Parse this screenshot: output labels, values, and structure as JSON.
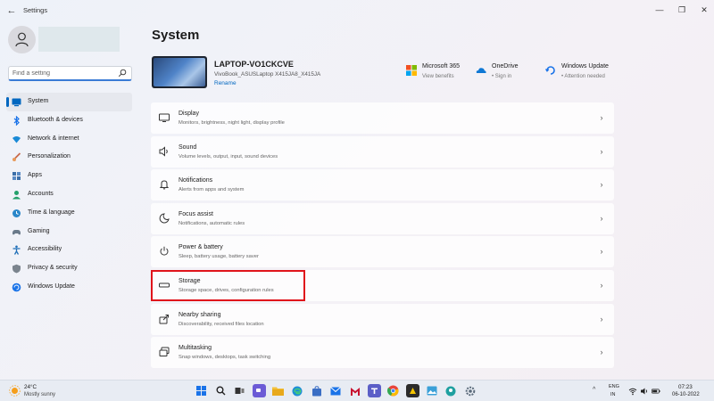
{
  "window": {
    "title": "Settings",
    "back_icon": "back-arrow-icon",
    "controls": {
      "minimize": "—",
      "maximize": "❐",
      "close": "✕"
    }
  },
  "sidebar": {
    "search_placeholder": "Find a setting",
    "items": [
      {
        "label": "System",
        "icon": "system-icon",
        "active": true,
        "color": "#0067c0"
      },
      {
        "label": "Bluetooth & devices",
        "icon": "bluetooth-icon",
        "color": "#1a73e8"
      },
      {
        "label": "Network & internet",
        "icon": "wifi-icon",
        "color": "#1a8ad6"
      },
      {
        "label": "Personalization",
        "icon": "brush-icon",
        "color": "#c8694a"
      },
      {
        "label": "Apps",
        "icon": "apps-icon",
        "color": "#3b6ea8"
      },
      {
        "label": "Accounts",
        "icon": "person-icon",
        "color": "#25a06b"
      },
      {
        "label": "Time & language",
        "icon": "globe-clock-icon",
        "color": "#2a87c9"
      },
      {
        "label": "Gaming",
        "icon": "gamepad-icon",
        "color": "#6a7a8a"
      },
      {
        "label": "Accessibility",
        "icon": "accessibility-icon",
        "color": "#1f6fb8"
      },
      {
        "label": "Privacy & security",
        "icon": "shield-icon",
        "color": "#7b848e"
      },
      {
        "label": "Windows Update",
        "icon": "update-icon",
        "color": "#1a73e8"
      }
    ]
  },
  "main": {
    "title": "System",
    "device": {
      "name": "LAPTOP-VO1CKCVE",
      "model": "VivoBook_ASUSLaptop X415JA8_X415JA",
      "rename": "Rename"
    },
    "quick_links": [
      {
        "title": "Microsoft 365",
        "sub": "View benefits",
        "icon": "microsoft-365-icon"
      },
      {
        "title": "OneDrive",
        "sub": "• Sign in",
        "icon": "onedrive-icon"
      },
      {
        "title": "Windows Update",
        "sub": "• Attention needed",
        "icon": "windows-update-icon"
      }
    ],
    "settings": [
      {
        "title": "Display",
        "desc": "Monitors, brightness, night light, display profile",
        "icon": "display-icon"
      },
      {
        "title": "Sound",
        "desc": "Volume levels, output, input, sound devices",
        "icon": "speaker-icon"
      },
      {
        "title": "Notifications",
        "desc": "Alerts from apps and system",
        "icon": "bell-icon"
      },
      {
        "title": "Focus assist",
        "desc": "Notifications, automatic rules",
        "icon": "moon-icon"
      },
      {
        "title": "Power & battery",
        "desc": "Sleep, battery usage, battery saver",
        "icon": "power-icon"
      },
      {
        "title": "Storage",
        "desc": "Storage space, drives, configuration rules",
        "icon": "storage-icon"
      },
      {
        "title": "Nearby sharing",
        "desc": "Discoverability, received files location",
        "icon": "share-icon"
      },
      {
        "title": "Multitasking",
        "desc": "Snap windows, desktops, task switching",
        "icon": "multitask-icon"
      }
    ],
    "highlight_color": "#e0141b"
  },
  "taskbar": {
    "weather_temp": "24°C",
    "weather_desc": "Mostly sunny",
    "lang_line1": "ENG",
    "lang_line2": "IN",
    "time": "07:23",
    "date": "06-10-2022",
    "tray_up": "^",
    "apps": [
      {
        "icon": "windows-start-icon",
        "color": "#1a73e8"
      },
      {
        "icon": "search-icon",
        "color": "#222222"
      },
      {
        "icon": "task-view-icon",
        "color": "#333333"
      },
      {
        "icon": "chat-icon",
        "color": "#6b5bd6"
      },
      {
        "icon": "file-explorer-icon",
        "color": "#e8b23a"
      },
      {
        "icon": "edge-icon",
        "color": "#1f8fd6"
      },
      {
        "icon": "store-icon",
        "color": "#3a6ec4"
      },
      {
        "icon": "mail-icon",
        "color": "#1a73e8"
      },
      {
        "icon": "mcafee-icon",
        "color": "#c8102e"
      },
      {
        "icon": "teams-icon",
        "color": "#5b5fc7"
      },
      {
        "icon": "chrome-icon",
        "color": "#e8453c"
      },
      {
        "icon": "app-icon",
        "color": "#2b2b2b"
      },
      {
        "icon": "photos-icon",
        "color": "#3aa0d8"
      },
      {
        "icon": "maps-icon",
        "color": "#1fa0a0"
      },
      {
        "icon": "settings-gear-icon",
        "color": "#5a6a7a"
      }
    ]
  }
}
